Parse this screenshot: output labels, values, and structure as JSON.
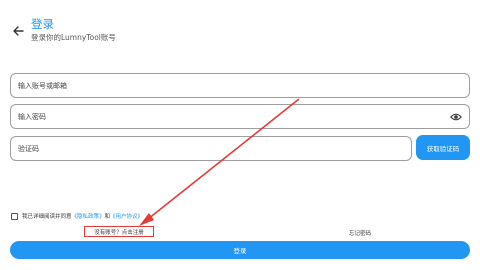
{
  "header": {
    "title": "登录",
    "subtitle": "登录你的LumnyTool账号",
    "back_icon": "arrow-left-icon"
  },
  "form": {
    "account_placeholder": "输入账号或邮箱",
    "password_placeholder": "输入密码",
    "code_placeholder": "验证码",
    "get_code_label": "获取验证码",
    "password_toggle_icon": "eye-icon"
  },
  "agreement": {
    "prefix": "我已详细阅读并同意",
    "privacy_link": "《隐私政策》",
    "and": "和",
    "terms_link": "《用户协议》"
  },
  "links": {
    "register": "没有账号？点击注册",
    "forgot": "忘记密码"
  },
  "login_button": "登录",
  "colors": {
    "accent": "#2196f3",
    "annotation": "#e53935"
  }
}
